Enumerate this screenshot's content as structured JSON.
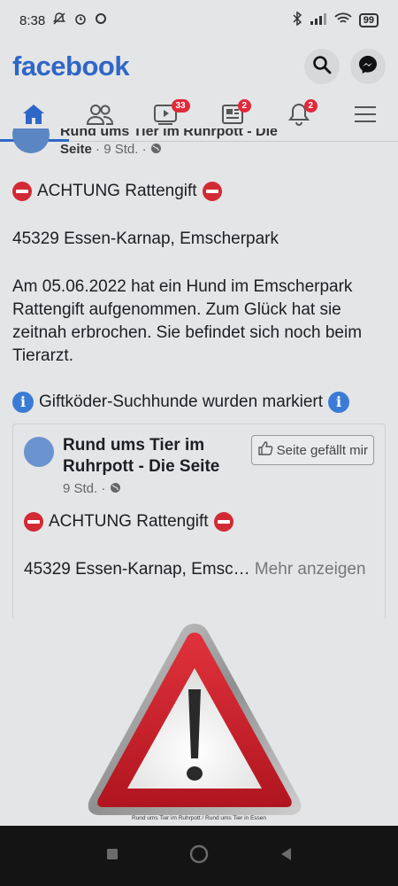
{
  "status": {
    "time": "8:38",
    "battery": "99"
  },
  "app": {
    "title": "facebook"
  },
  "nav": {
    "badge_watch": "33",
    "badge_pages": "2",
    "badge_notifications": "2"
  },
  "post": {
    "author_clipped": "Rund ums Tier im Ruhrpott - Die",
    "author_tail": "Seite",
    "time": "9 Std.",
    "headline": "ACHTUNG Rattengift",
    "location": "45329 Essen-Karnap, Emscherpark",
    "paragraph": "Am 05.06.2022 hat ein Hund im Emscherpark Rattengift aufgenommen. Zum Glück hat sie zeitnah erbrochen. Sie befindet sich noch beim Tierarzt.",
    "info_line": "Giftköder-Suchhunde wurden markiert"
  },
  "shared": {
    "page_name": "Rund ums Tier im Ruhrpott - Die Seite",
    "like_label": "Seite gefällt mir",
    "time": "9 Std.",
    "headline": "ACHTUNG Rattengift",
    "excerpt": "45329 Essen-Karnap, Emsc…",
    "more_label": "Mehr anzeigen"
  },
  "image": {
    "caption": "Rund ums Tier im Ruhrpott / Rund ums Tier in Essen"
  },
  "colors": {
    "brand": "#2f67c6",
    "badge": "#e0293b",
    "stop": "#d22a35",
    "info": "#3a7bd5"
  }
}
